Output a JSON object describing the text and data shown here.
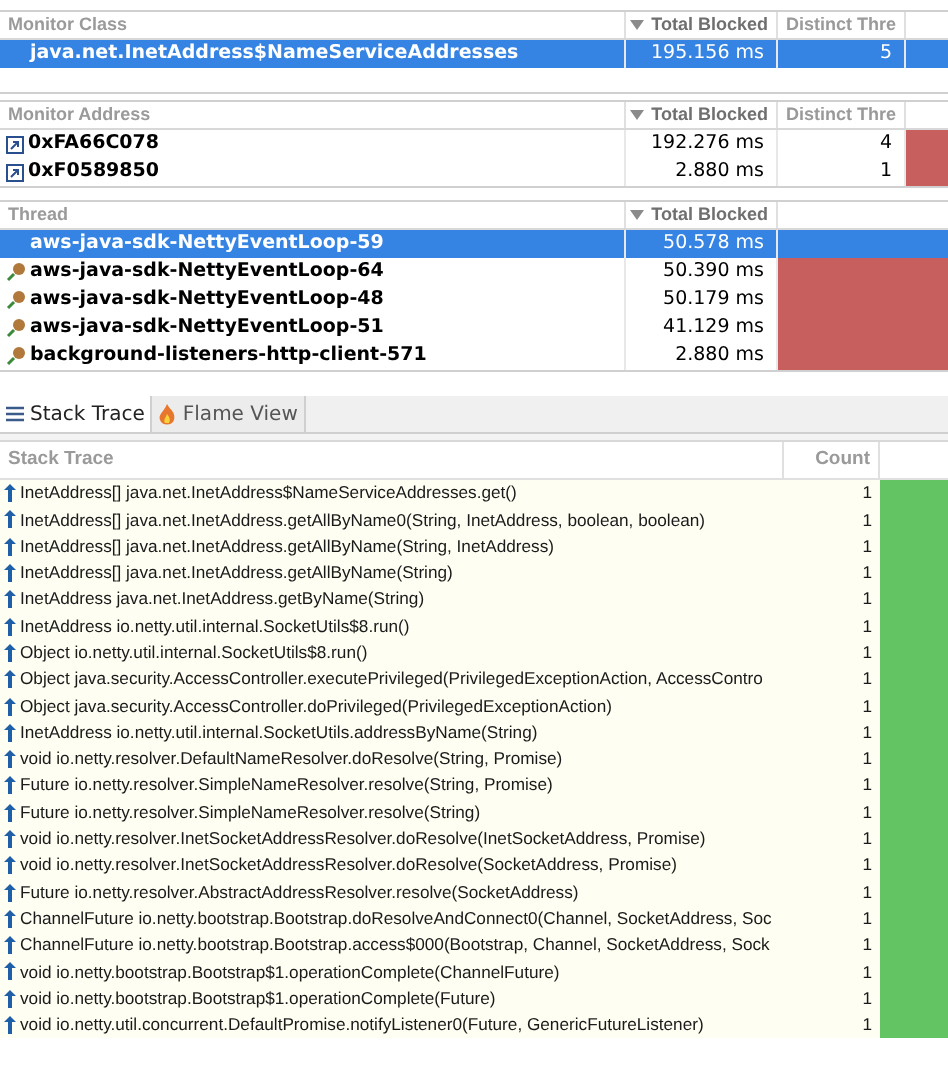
{
  "monitor_class_table": {
    "columns": [
      {
        "label": "Monitor Class",
        "sorted": false
      },
      {
        "label": "Total Blocked",
        "sorted": true
      },
      {
        "label": "Distinct Thre",
        "sorted": false
      }
    ],
    "rows": [
      {
        "name": "java.net.InetAddress$NameServiceAddresses",
        "total_blocked": "195.156 ms",
        "distinct_threads": "5",
        "selected": true
      }
    ]
  },
  "monitor_address_table": {
    "columns": [
      {
        "label": "Monitor Address",
        "sorted": false
      },
      {
        "label": "Total Blocked",
        "sorted": true
      },
      {
        "label": "Distinct Thre",
        "sorted": false
      }
    ],
    "rows": [
      {
        "name": "0xFA66C078",
        "total_blocked": "192.276 ms",
        "distinct_threads": "4",
        "selected": false
      },
      {
        "name": "0xF0589850",
        "total_blocked": "2.880 ms",
        "distinct_threads": "1",
        "selected": false
      }
    ]
  },
  "thread_table": {
    "columns": [
      {
        "label": "Thread",
        "sorted": false
      },
      {
        "label": "Total Blocked",
        "sorted": true
      }
    ],
    "rows": [
      {
        "name": "aws-java-sdk-NettyEventLoop-59",
        "total_blocked": "50.578 ms",
        "selected": true
      },
      {
        "name": "aws-java-sdk-NettyEventLoop-64",
        "total_blocked": "50.390 ms",
        "selected": false
      },
      {
        "name": "aws-java-sdk-NettyEventLoop-48",
        "total_blocked": "50.179 ms",
        "selected": false
      },
      {
        "name": "aws-java-sdk-NettyEventLoop-51",
        "total_blocked": "41.129 ms",
        "selected": false
      },
      {
        "name": "background-listeners-http-client-571",
        "total_blocked": "2.880 ms",
        "selected": false
      }
    ]
  },
  "tabs": [
    {
      "label": "Stack Trace",
      "kind": "list",
      "selected": true
    },
    {
      "label": "Flame View",
      "kind": "flame",
      "selected": false
    }
  ],
  "stack_trace_table": {
    "columns": [
      "Stack Trace",
      "Count"
    ],
    "rows": [
      {
        "frame": "InetAddress[] java.net.InetAddress$NameServiceAddresses.get()",
        "count": "1"
      },
      {
        "frame": "InetAddress[] java.net.InetAddress.getAllByName0(String, InetAddress, boolean, boolean)",
        "count": "1"
      },
      {
        "frame": "InetAddress[] java.net.InetAddress.getAllByName(String, InetAddress)",
        "count": "1"
      },
      {
        "frame": "InetAddress[] java.net.InetAddress.getAllByName(String)",
        "count": "1"
      },
      {
        "frame": "InetAddress java.net.InetAddress.getByName(String)",
        "count": "1"
      },
      {
        "frame": "InetAddress io.netty.util.internal.SocketUtils$8.run()",
        "count": "1"
      },
      {
        "frame": "Object io.netty.util.internal.SocketUtils$8.run()",
        "count": "1"
      },
      {
        "frame": "Object java.security.AccessController.executePrivileged(PrivilegedExceptionAction, AccessContro",
        "count": "1"
      },
      {
        "frame": "Object java.security.AccessController.doPrivileged(PrivilegedExceptionAction)",
        "count": "1"
      },
      {
        "frame": "InetAddress io.netty.util.internal.SocketUtils.addressByName(String)",
        "count": "1"
      },
      {
        "frame": "void io.netty.resolver.DefaultNameResolver.doResolve(String, Promise)",
        "count": "1"
      },
      {
        "frame": "Future io.netty.resolver.SimpleNameResolver.resolve(String, Promise)",
        "count": "1"
      },
      {
        "frame": "Future io.netty.resolver.SimpleNameResolver.resolve(String)",
        "count": "1"
      },
      {
        "frame": "void io.netty.resolver.InetSocketAddressResolver.doResolve(InetSocketAddress, Promise)",
        "count": "1"
      },
      {
        "frame": "void io.netty.resolver.InetSocketAddressResolver.doResolve(SocketAddress, Promise)",
        "count": "1"
      },
      {
        "frame": "Future io.netty.resolver.AbstractAddressResolver.resolve(SocketAddress)",
        "count": "1"
      },
      {
        "frame": "ChannelFuture io.netty.bootstrap.Bootstrap.doResolveAndConnect0(Channel, SocketAddress, Soc",
        "count": "1"
      },
      {
        "frame": "ChannelFuture io.netty.bootstrap.Bootstrap.access$000(Bootstrap, Channel, SocketAddress, Sock",
        "count": "1"
      },
      {
        "frame": "void io.netty.bootstrap.Bootstrap$1.operationComplete(ChannelFuture)",
        "count": "1"
      },
      {
        "frame": "void io.netty.bootstrap.Bootstrap$1.operationComplete(Future)",
        "count": "1"
      },
      {
        "frame": "void io.netty.util.concurrent.DefaultPromise.notifyListener0(Future, GenericFutureListener)",
        "count": "1"
      }
    ]
  }
}
